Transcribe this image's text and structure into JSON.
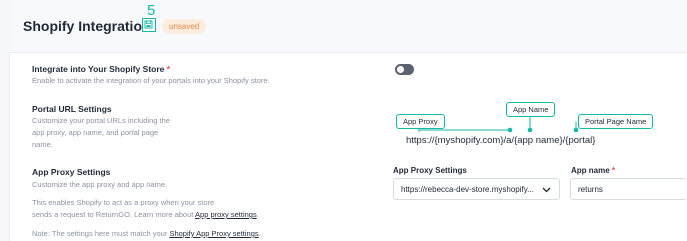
{
  "header": {
    "title": "Shopify Integration",
    "step_number": "5",
    "status_badge": "unsaved"
  },
  "integrate": {
    "title": "Integrate into Your Shopify Store",
    "required_mark": "*",
    "description": "Enable to activate the integration of your portals into your Shopify store.",
    "enabled": false
  },
  "portal_url": {
    "title": "Portal URL Settings",
    "description_lines": [
      "Customize your portal URLs including the",
      "app proxy, app name, and portal page",
      "name."
    ],
    "diagram": {
      "callout_app_proxy": "App Proxy",
      "callout_app_name": "App Name",
      "callout_portal_page": "Portal Page Name",
      "url_example": "https://{myshopify.com}/a/{app name}/{portal}"
    }
  },
  "app_proxy": {
    "title": "App Proxy Settings",
    "description": "Customize the app proxy and app name.",
    "info_line1": "This enables Shopify to act as a proxy when your store",
    "info_line2_prefix": "sends a request to ReturnGO. Learn more about ",
    "info_link": "App proxy settings",
    "info_line2_suffix": ".",
    "note_prefix": "Note: The settings here must match your ",
    "note_link": "Shopify App Proxy settings",
    "note_suffix": ".",
    "select_label": "App Proxy Settings",
    "select_value": "https://rebecca-dev-store.myshopify...",
    "app_name_label": "App name",
    "app_name_required": "*",
    "app_name_value": "returns"
  },
  "colors": {
    "accent": "#14b8a6",
    "badge_bg": "#fdebdc",
    "badge_text": "#e08a4b",
    "required": "#ef4444"
  }
}
